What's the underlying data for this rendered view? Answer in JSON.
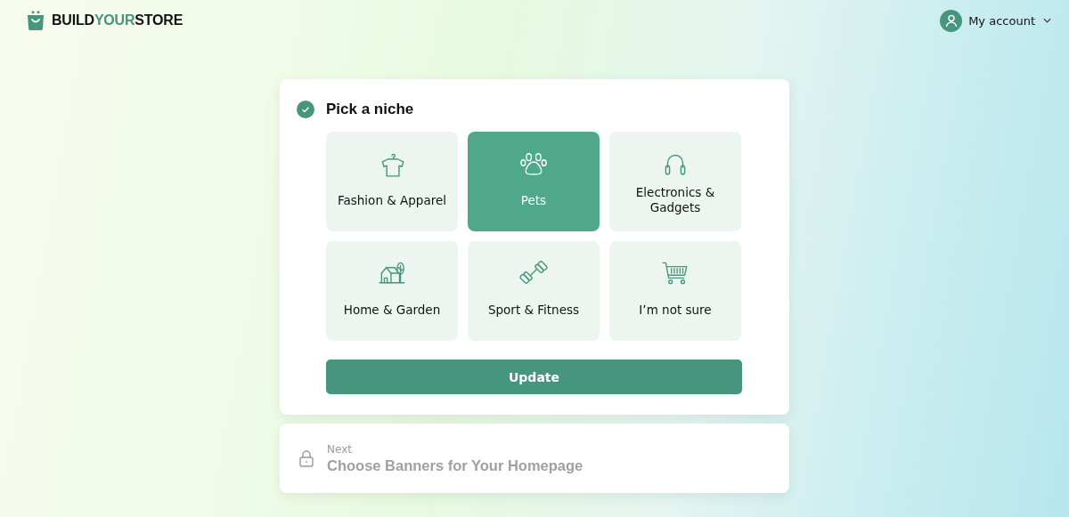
{
  "header": {
    "logo": [
      {
        "text": "BUILD",
        "accent": false
      },
      {
        "text": "YOUR",
        "accent": true
      },
      {
        "text": "STORE",
        "accent": false
      }
    ],
    "account": {
      "label": "My account"
    }
  },
  "step": {
    "title": "Pick a niche",
    "completed": true,
    "niches": [
      {
        "label": "Fashion & Apparel",
        "kind": "shirt",
        "selected": false
      },
      {
        "label": "Pets",
        "kind": "paw",
        "selected": true
      },
      {
        "label": "Electronics & Gadgets",
        "kind": "headphones",
        "selected": false
      },
      {
        "label": "Home & Garden",
        "kind": "house",
        "selected": false
      },
      {
        "label": "Sport & Fitness",
        "kind": "dumbbell",
        "selected": false
      },
      {
        "label": "I’m not sure",
        "kind": "cart",
        "selected": false
      }
    ],
    "button": "Update"
  },
  "next_step": {
    "caption": "Next",
    "title": "Choose Banners for Your Homepage",
    "locked": true
  }
}
